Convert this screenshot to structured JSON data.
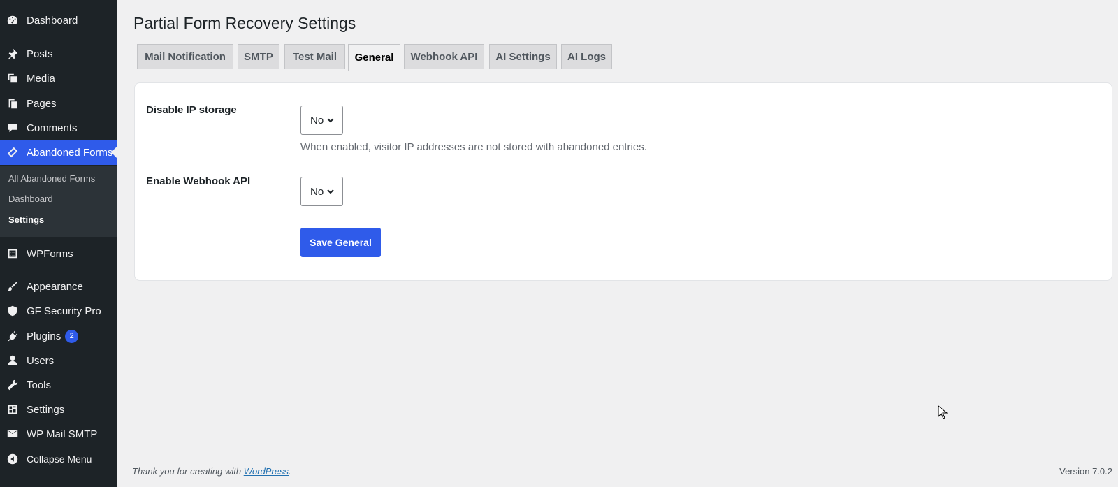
{
  "sidebar": {
    "items": [
      {
        "label": "Dashboard",
        "icon": "dashboard-icon"
      },
      {
        "label": "Posts",
        "icon": "pin-icon"
      },
      {
        "label": "Media",
        "icon": "media-icon"
      },
      {
        "label": "Pages",
        "icon": "pages-icon"
      },
      {
        "label": "Comments",
        "icon": "comment-icon"
      },
      {
        "label": "Abandoned Forms",
        "icon": "form-icon"
      },
      {
        "label": "WPForms",
        "icon": "wpforms-icon"
      },
      {
        "label": "Appearance",
        "icon": "brush-icon"
      },
      {
        "label": "GF Security Pro",
        "icon": "shield-icon"
      },
      {
        "label": "Plugins",
        "icon": "plugin-icon",
        "badge": "2"
      },
      {
        "label": "Users",
        "icon": "user-icon"
      },
      {
        "label": "Tools",
        "icon": "wrench-icon"
      },
      {
        "label": "Settings",
        "icon": "settings-icon"
      },
      {
        "label": "WP Mail SMTP",
        "icon": "mail-icon"
      },
      {
        "label": "Collapse Menu",
        "icon": "collapse-icon"
      }
    ],
    "submenu": [
      "All Abandoned Forms",
      "Dashboard",
      "Settings"
    ],
    "active_color": "#2f5bea"
  },
  "page": {
    "title": "Partial Form Recovery Settings",
    "tabs": [
      "Mail Notification",
      "SMTP",
      "Test Mail",
      "General",
      "Webhook API",
      "AI Settings",
      "AI Logs"
    ],
    "active_tab": "General"
  },
  "form": {
    "disable_ip": {
      "label": "Disable IP storage",
      "value": "No",
      "description": "When enabled, visitor IP addresses are not stored with abandoned entries."
    },
    "enable_webhook": {
      "label": "Enable Webhook API",
      "value": "No"
    },
    "save_label": "Save General"
  },
  "footer": {
    "text": "Thank you for creating with",
    "link": "WordPress",
    "suffix": ".",
    "version": "Version 7.0.2"
  }
}
